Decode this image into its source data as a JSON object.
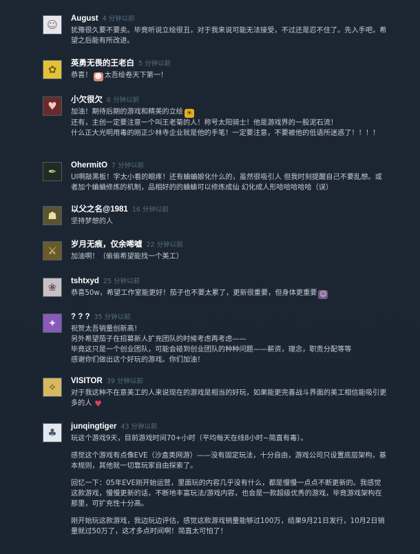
{
  "comments": [
    {
      "author": "August",
      "timestamp": "4 分钟以前",
      "avatar": {
        "icon": "cartoon-face",
        "bg": "#e8e6ea",
        "fg": "#7a6a7e",
        "glyph": "☺"
      },
      "paragraphs": [
        "犹豫很久要不要卖。毕竟听说立绘很丑，对于我来说可能无法接受，不过还是忍不住了。先入手吧，希望之后能有所改进。"
      ]
    },
    {
      "author": "英勇无畏的王老白",
      "timestamp": "5 分钟以前",
      "avatar": {
        "icon": "yellow-chick",
        "bg": "#e2c23a",
        "fg": "#7a5a10",
        "glyph": "✿"
      },
      "paragraphs": [
        "恭喜！",
        "太吾绘卷天下第一！"
      ],
      "emoticon": "girl-face-emoticon"
    },
    {
      "author": "小欠很欠",
      "timestamp": "6 分钟以前",
      "avatar": {
        "icon": "anime-girl",
        "bg": "#6b2a2a",
        "fg": "#f0c8c8",
        "glyph": "♥"
      },
      "paragraphs": [
        "加油！期待后期的游戏和精美的立绘",
        "还有，主创一定要注意一个叫王老菊的人！称号太阳骑士！他是游戏界的一股泥石流！\n什么正大光明用毒的刚正少林寺企业就是他的手笔！一定要注意，不要被他的低语所迷惑了！！！！"
      ],
      "emoticon": "sun-emoticon"
    },
    {
      "author": "OhermitO",
      "timestamp": "7 分钟以前",
      "avatar": {
        "icon": "feather",
        "bg": "#232a22",
        "fg": "#b8c0a0",
        "glyph": "✒"
      },
      "paragraphs": [
        "UI啊敲黑板！字太小看的眼疼！还有蛐蛐娘化什么的，虽然很吸引人 但我时刻提醒自己不要乱想。或者加个蛐蛐修炼的机制，品相好的的蛐蛐可以修炼成仙 幻化成人形哈哈哈哈哈（误）"
      ]
    },
    {
      "author": "以父之名@1981",
      "timestamp": "16 分钟以前",
      "avatar": {
        "icon": "hooded-figure",
        "bg": "#5a5430",
        "fg": "#e6dfa8",
        "glyph": "☗"
      },
      "paragraphs": [
        "坚持梦想的人"
      ]
    },
    {
      "author": "岁月无痕，仅余唏嘘",
      "timestamp": "22 分钟以前",
      "avatar": {
        "icon": "pixel-warrior",
        "bg": "#6a5a2a",
        "fg": "#f0d890",
        "glyph": "⚔"
      },
      "paragraphs": [
        "加油啊！（偷偷希望能找一个美工）"
      ]
    },
    {
      "author": "tshtxyd",
      "timestamp": "25 分钟以前",
      "avatar": {
        "icon": "silver-hair-girl",
        "bg": "#c8c0c4",
        "fg": "#6a5460",
        "glyph": "❀"
      },
      "paragraphs": [
        "恭喜50w，希望工作室能更好！茄子也不要太累了，更新很重要，但身体更重要"
      ],
      "emoticon": "girl-emoticon"
    },
    {
      "author": "? ? ?",
      "timestamp": "35 分钟以前",
      "avatar": {
        "icon": "purple-hair-girl",
        "bg": "#8a5ab8",
        "fg": "#f4e0ff",
        "glyph": "✦"
      },
      "paragraphs": [
        "祝贺太吾销量创新高！\n另外希望茄子在招募新人扩充团队的时候考虑再考虑——\n毕竟这只是一个创业团队，可能会碰到创业团队的种种问题——薪资，理念，职责分配等等\n感谢你们做出这个好玩的游戏。你们加油！"
      ]
    },
    {
      "author": "VISITOR",
      "timestamp": "39 分钟以前",
      "avatar": {
        "icon": "blonde-girl",
        "bg": "#d8b860",
        "fg": "#5a4010",
        "glyph": "✧"
      },
      "paragraphs": [
        "对于我这种不在意美工的人来说现在的游戏是相当的好玩，如果能更完善战斗界面的美工相信能吸引更多的人"
      ],
      "emoticon": "heart-lips-emoticon"
    },
    {
      "author": "junqingtiger",
      "timestamp": "43 分钟以前",
      "avatar": {
        "icon": "white-tiger",
        "bg": "#e4e8ee",
        "fg": "#4a5a70",
        "glyph": "♣"
      },
      "paragraphs": [
        "玩这个游戏9天，目前游戏时间70+小时（平均每天在线8小时~简直有毒）。",
        "感觉这个游戏有点像EVE（沙盒类网游）——没有固定玩法，十分自由，游戏公司只设置底层架构，基本规则，其他就一切靠玩家自由探索了。",
        "回忆一下：05年EVE刚开始运营，里面玩的内容几乎没有什么，都是慢慢一点点不断更新的。我感觉这款游戏，慢慢更新的话，不断地丰富玩法/游戏内容，也会是一款超级优秀的游戏，毕竟游戏架构在那里，可扩充性十分高。",
        "刚开始玩这款游戏，我边玩边评估，感觉这款游戏销量能够过100万，结果9月21日发行，10月2日销量就过50万了，这才多点时间啊！简直太可怕了！"
      ]
    }
  ]
}
